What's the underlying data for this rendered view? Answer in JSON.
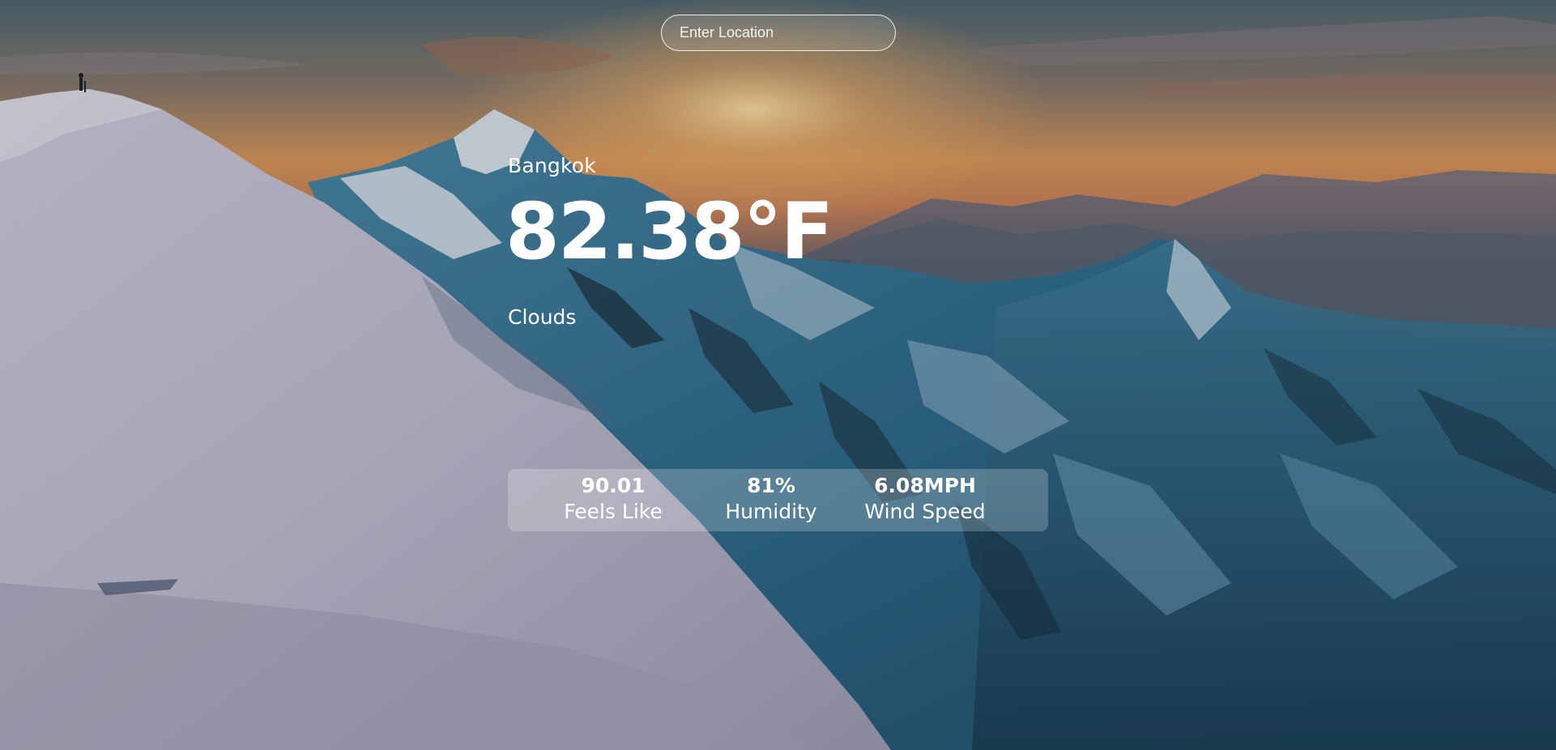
{
  "search": {
    "placeholder": "Enter Location"
  },
  "weather": {
    "city": "Bangkok",
    "temperature": "82.38°F",
    "condition": "Clouds"
  },
  "stats": {
    "feels_like": {
      "value": "90.01",
      "label": "Feels Like"
    },
    "humidity": {
      "value": "81%",
      "label": "Humidity"
    },
    "wind_speed": {
      "value": "6.08MPH",
      "label": "Wind Speed"
    }
  },
  "background": {
    "subject": "snowy mountain ridge at sunset",
    "colors": {
      "sky_top": "#5d6f78",
      "sky_glow": "#e8a15a",
      "snow_light": "#d6d8e4",
      "snow_shadow": "#2f5d76",
      "rock_dark": "#1c2f3c"
    }
  }
}
